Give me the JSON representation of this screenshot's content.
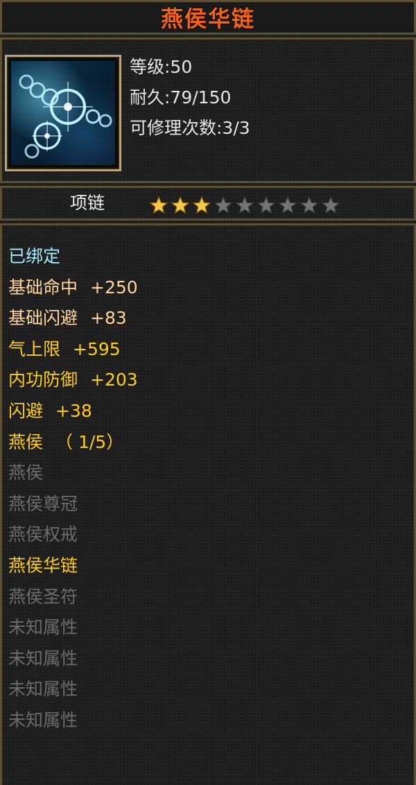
{
  "item": {
    "name": "燕侯华链",
    "level_text": "等级:50",
    "durability_text": "耐久:79/150",
    "repair_text": "可修理次数:3/3",
    "type": "项链",
    "stars_filled": 3,
    "stars_total": 9
  },
  "colors": {
    "title": "#f2631b",
    "bound": "#a6ecff",
    "base_attr": "#ffd39a",
    "bonus_attr": "#ffcc22",
    "set_active": "#ffcc22",
    "set_inactive": "#6c6c6c",
    "star_filled": "#f4c84a",
    "star_empty": "#747474"
  },
  "properties": [
    {
      "label": "已绑定",
      "value": "",
      "color": "bound"
    },
    {
      "label": "基础命中",
      "value": "+250",
      "color": "base_attr"
    },
    {
      "label": "基础闪避",
      "value": "+83",
      "color": "base_attr"
    },
    {
      "label": "气上限",
      "value": "+595",
      "color": "bonus_attr"
    },
    {
      "label": "内功防御",
      "value": "+203",
      "color": "bonus_attr"
    },
    {
      "label": "闪避",
      "value": "+38",
      "color": "bonus_attr"
    },
    {
      "label": "燕侯",
      "value": "（ 1/5）",
      "color": "set_active"
    },
    {
      "label": "燕侯",
      "value": "",
      "color": "set_inactive"
    },
    {
      "label": "燕侯尊冠",
      "value": "",
      "color": "set_inactive"
    },
    {
      "label": "燕侯权戒",
      "value": "",
      "color": "set_inactive"
    },
    {
      "label": "燕侯华链",
      "value": "",
      "color": "set_active"
    },
    {
      "label": "燕侯圣符",
      "value": "",
      "color": "set_inactive"
    },
    {
      "label": "未知属性",
      "value": "",
      "color": "set_inactive"
    },
    {
      "label": "未知属性",
      "value": "",
      "color": "set_inactive"
    },
    {
      "label": "未知属性",
      "value": "",
      "color": "set_inactive"
    },
    {
      "label": "未知属性",
      "value": "",
      "color": "set_inactive"
    }
  ]
}
